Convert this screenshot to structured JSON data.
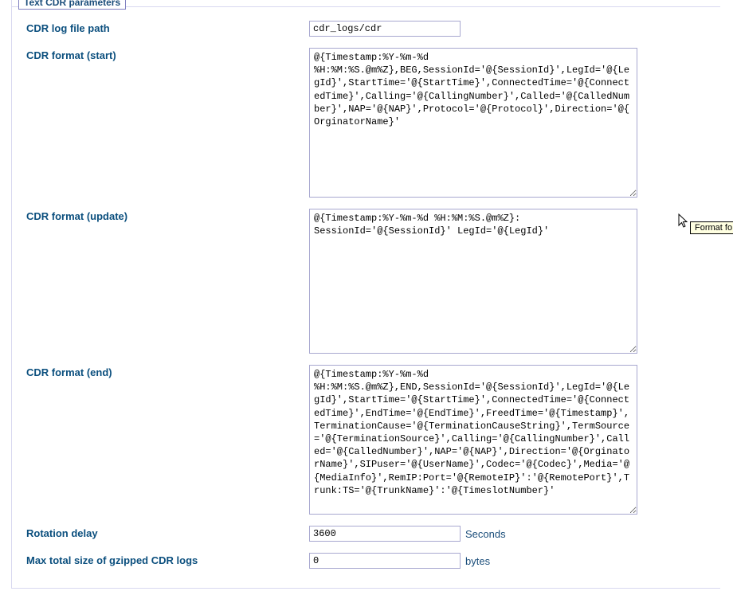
{
  "fieldset": {
    "legend": "Text CDR parameters",
    "rows": {
      "log_path": {
        "label": "CDR log file path",
        "value": "cdr_logs/cdr"
      },
      "format_start": {
        "label": "CDR format (start)",
        "value": "@{Timestamp:%Y-%m-%d %H:%M:%S.@m%Z},BEG,SessionId='@{SessionId}',LegId='@{LegId}',StartTime='@{StartTime}',ConnectedTime='@{ConnectedTime}',Calling='@{CallingNumber}',Called='@{CalledNumber}',NAP='@{NAP}',Protocol='@{Protocol}',Direction='@{OrginatorName}'"
      },
      "format_update": {
        "label": "CDR format (update)",
        "value": "@{Timestamp:%Y-%m-%d %H:%M:%S.@m%Z}: SessionId='@{SessionId}' LegId='@{LegId}'"
      },
      "format_end": {
        "label": "CDR format (end)",
        "value": "@{Timestamp:%Y-%m-%d %H:%M:%S.@m%Z},END,SessionId='@{SessionId}',LegId='@{LegId}',StartTime='@{StartTime}',ConnectedTime='@{ConnectedTime}',EndTime='@{EndTime}',FreedTime='@{Timestamp}',TerminationCause='@{TerminationCauseString}',TermSource='@{TerminationSource}',Calling='@{CallingNumber}',Called='@{CalledNumber}',NAP='@{NAP}',Direction='@{OrginatorName}',SIPuser='@{UserName}',Codec='@{Codec}',Media='@{MediaInfo}',RemIP:Port='@{RemoteIP}':'@{RemotePort}',Trunk:TS='@{TrunkName}':'@{TimeslotNumber}'"
      },
      "rotation_delay": {
        "label": "Rotation delay",
        "value": "3600",
        "unit": "Seconds"
      },
      "max_size": {
        "label": "Max total size of gzipped CDR logs",
        "value": "0",
        "unit": "bytes"
      }
    }
  },
  "tooltip": "Format fo"
}
